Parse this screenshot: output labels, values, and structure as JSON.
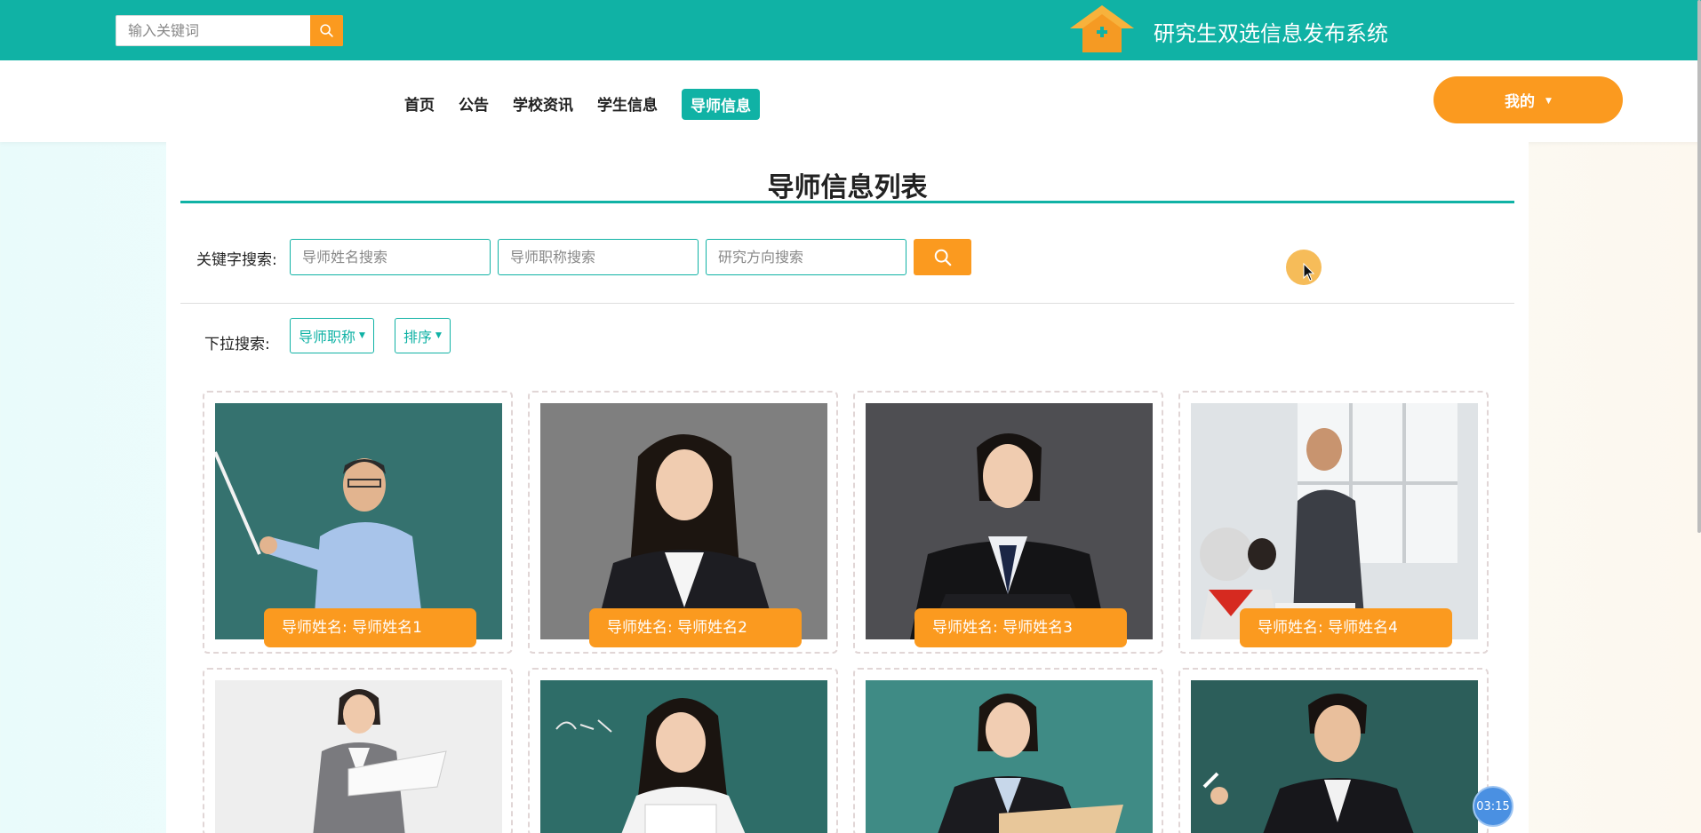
{
  "top": {
    "search_placeholder": "输入关键词",
    "site_title": "研究生双选信息发布系统"
  },
  "nav": {
    "items": [
      "首页",
      "公告",
      "学校资讯",
      "学生信息",
      "导师信息"
    ],
    "active": "导师信息",
    "my_label": "我的"
  },
  "main": {
    "title": "导师信息列表",
    "keyword_label": "关键字搜索:",
    "search_placeholders": [
      "导师姓名搜索",
      "导师职称搜索",
      "研究方向搜索"
    ],
    "dropdown_label": "下拉搜索:",
    "dropdowns": [
      "导师职称",
      "排序"
    ]
  },
  "cards": [
    {
      "label": "导师姓名: 导师姓名1"
    },
    {
      "label": "导师姓名: 导师姓名2"
    },
    {
      "label": "导师姓名: 导师姓名3"
    },
    {
      "label": "导师姓名: 导师姓名4"
    },
    {
      "label": ""
    },
    {
      "label": ""
    },
    {
      "label": ""
    },
    {
      "label": ""
    }
  ],
  "timer": "03:15",
  "colors": {
    "teal": "#10b2a5",
    "orange": "#fb9a1f"
  }
}
